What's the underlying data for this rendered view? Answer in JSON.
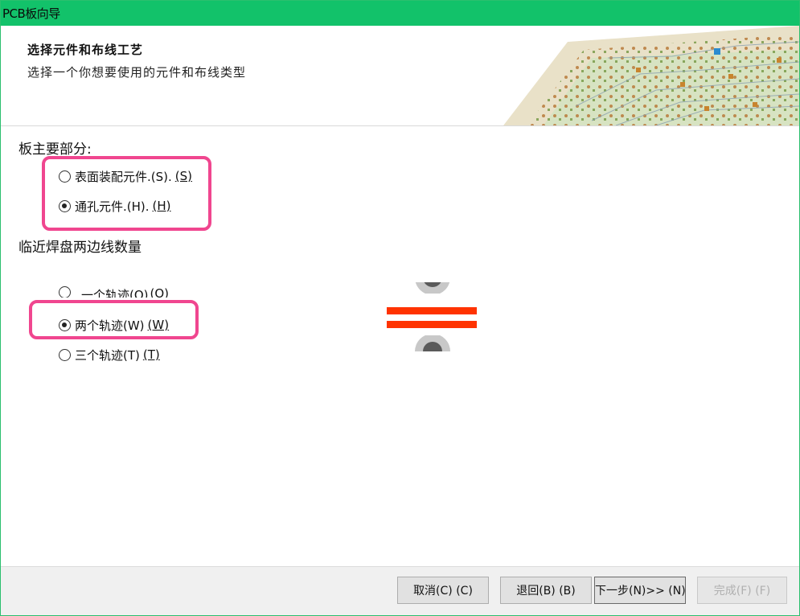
{
  "window": {
    "title": "PCB板向导"
  },
  "header": {
    "title": "选择元件和布线工艺",
    "subtitle": "选择一个你想要使用的元件和布线类型"
  },
  "board_section": {
    "label": "板主要部分:",
    "options": [
      {
        "label": "表面装配元件.(S).",
        "accel": "(S)",
        "checked": false
      },
      {
        "label": "通孔元件.(H).",
        "accel": "(H)",
        "checked": true
      }
    ]
  },
  "tracks_section": {
    "label": "临近焊盘两边线数量",
    "options": [
      {
        "label": "一个轨迹(O)",
        "accel": "(O)",
        "checked": false
      },
      {
        "label": "两个轨迹(W)",
        "accel": "(W)",
        "checked": true
      },
      {
        "label": "三个轨迹(T)",
        "accel": "(T)",
        "checked": false
      }
    ]
  },
  "colors": {
    "titlebar": "#12c26a",
    "highlight": "#f0468f",
    "track": "#ff3300",
    "pad": "#5a5a5a"
  },
  "footer": {
    "cancel": "取消(C) (C)",
    "back": "退回(B) (B)",
    "next": "下一步(N)>> (N) >",
    "finish": "完成(F) (F)"
  }
}
